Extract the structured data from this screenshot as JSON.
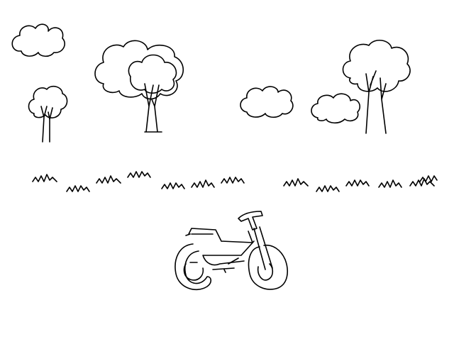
{
  "canvas": {
    "background_color": "#ffffff",
    "ink_color": "#000000"
  },
  "scene": {
    "style": "hand-drawn line sketch",
    "elements": [
      "cloud",
      "tree",
      "tree",
      "tree",
      "cloud",
      "cloud",
      "tree",
      "grass",
      "grass",
      "grass",
      "grass",
      "grass",
      "grass",
      "grass",
      "grass",
      "grass",
      "grass",
      "grass",
      "grass",
      "grass",
      "motorcycle"
    ]
  }
}
